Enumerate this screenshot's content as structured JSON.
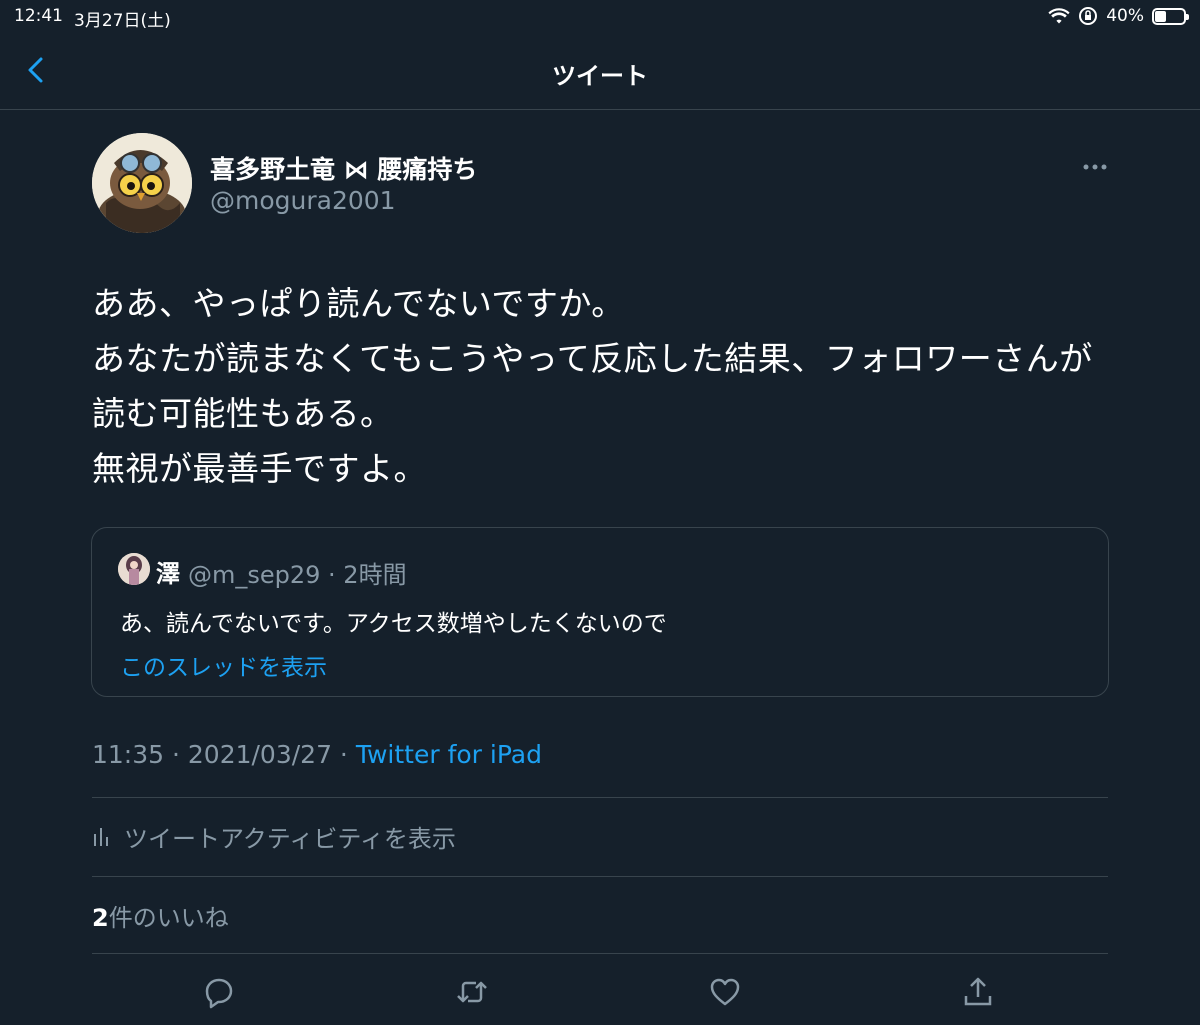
{
  "status_bar": {
    "time": "12:41",
    "date": "3月27日(土)",
    "battery_percent": "40%",
    "battery_level": 0.4
  },
  "nav": {
    "title": "ツイート"
  },
  "tweet": {
    "display_name": "喜多野土竜 ⋈ 腰痛持ち",
    "handle": "@mogura2001",
    "text": "ああ、やっぱり読んでないですか。\nあなたが読まなくてもこうやって反応した結果、フォロワーさんが読む可能性もある。\n無視が最善手ですよ。",
    "timestamp": "11:35 · 2021/03/27 · ",
    "source": "Twitter for iPad"
  },
  "quoted_tweet": {
    "name": "澤",
    "handle_time": "@m_sep29 · 2時間",
    "text": "あ、読んでないです。アクセス数増やしたくないので",
    "show_thread": "このスレッドを表示"
  },
  "activity": {
    "label": "ツイートアクティビティを表示"
  },
  "likes": {
    "count": "2",
    "label": "件のいいね"
  },
  "colors": {
    "background": "#15202b",
    "accent": "#1da1f2",
    "secondary_text": "#8899a6",
    "divider": "#38444d"
  },
  "icons": [
    "back-chevron-icon",
    "more-icon",
    "reply-icon",
    "retweet-icon",
    "like-icon",
    "share-icon",
    "activity-bar-icon",
    "wifi-icon",
    "rotation-lock-icon",
    "battery-icon"
  ]
}
